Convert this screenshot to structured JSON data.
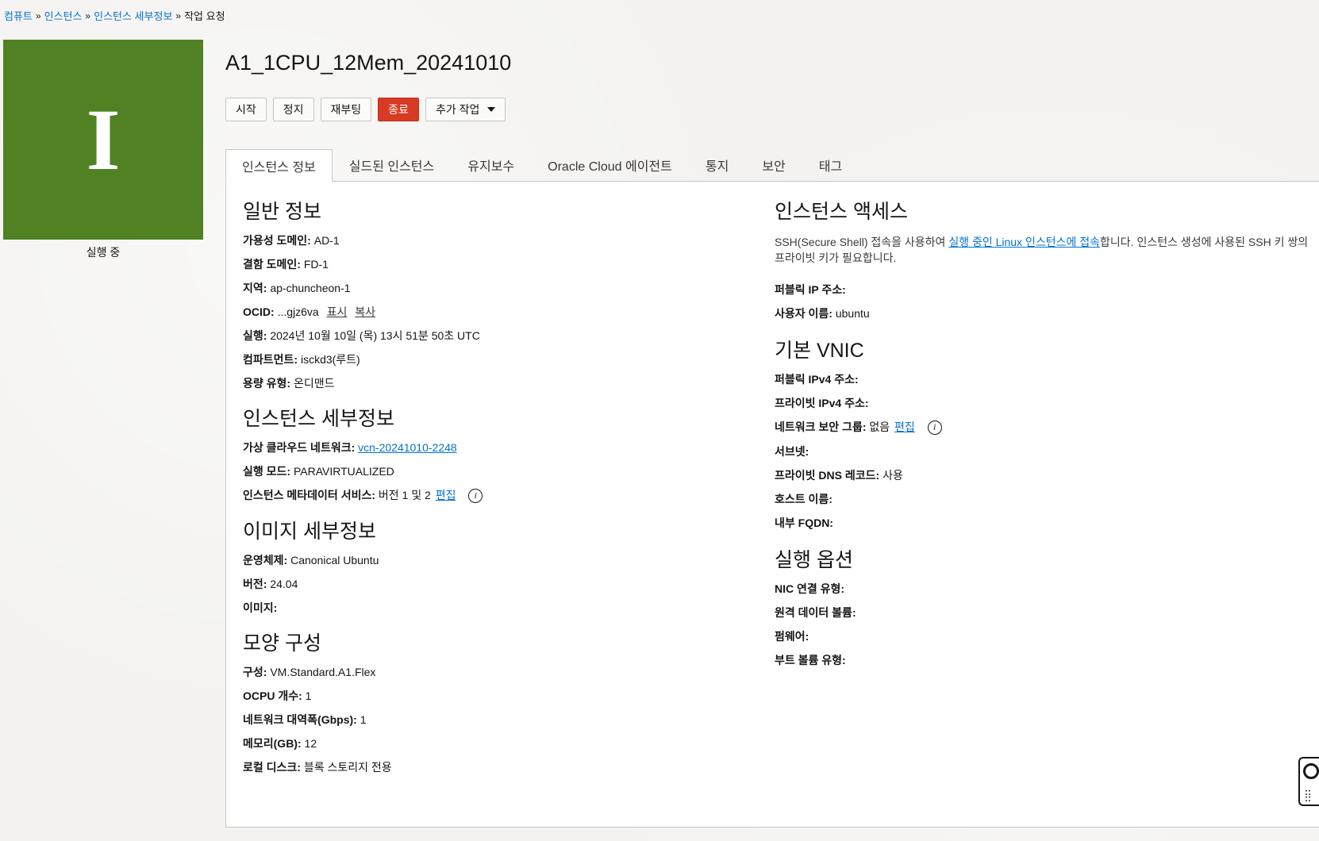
{
  "breadcrumb": {
    "items": [
      "컴퓨트",
      "인스턴스",
      "인스턴스 세부정보"
    ],
    "current": "작업 요청",
    "sep": "»"
  },
  "side": {
    "letter": "I",
    "status": "실행 중",
    "status_color": "#508223"
  },
  "header": {
    "title": "A1_1CPU_12Mem_20241010"
  },
  "actions": {
    "start": "시작",
    "stop": "정지",
    "reboot": "재부팅",
    "terminate": "종료",
    "more": "추가 작업"
  },
  "tabs": [
    "인스턴스 정보",
    "실드된 인스턴스",
    "유지보수",
    "Oracle Cloud 에이전트",
    "통지",
    "보안",
    "태그"
  ],
  "general": {
    "heading": "일반 정보",
    "availability_domain": {
      "k": "가용성 도메인:",
      "v": "AD-1"
    },
    "fault_domain": {
      "k": "결함 도메인:",
      "v": "FD-1"
    },
    "region": {
      "k": "지역:",
      "v": "ap-chuncheon-1"
    },
    "ocid": {
      "k": "OCID:",
      "v": "...gjz6va",
      "show": "표시",
      "copy": "복사"
    },
    "launched": {
      "k": "실행:",
      "v": "2024년 10월 10일 (목) 13시 51분 50초 UTC"
    },
    "compartment": {
      "k": "컴파트먼트:",
      "v": "isckd3(루트)"
    },
    "capacity_type": {
      "k": "용량 유형:",
      "v": "온디맨드"
    }
  },
  "instance_details": {
    "heading": "인스턴스 세부정보",
    "vcn": {
      "k": "가상 클라우드 네트워크:",
      "v": "vcn-20241010-2248"
    },
    "launch_mode": {
      "k": "실행 모드:",
      "v": "PARAVIRTUALIZED"
    },
    "metadata": {
      "k": "인스턴스 메타데이터 서비스:",
      "v": "버전 1 및 2",
      "edit": "편집"
    }
  },
  "image": {
    "heading": "이미지 세부정보",
    "os": {
      "k": "운영체제:",
      "v": "Canonical Ubuntu"
    },
    "version": {
      "k": "버전:",
      "v": "24.04"
    },
    "image": {
      "k": "이미지:",
      "v": ""
    }
  },
  "shape": {
    "heading": "모양 구성",
    "shape": {
      "k": "구성:",
      "v": "VM.Standard.A1.Flex"
    },
    "ocpu": {
      "k": "OCPU 개수:",
      "v": "1"
    },
    "bandwidth": {
      "k": "네트워크 대역폭(Gbps):",
      "v": "1"
    },
    "memory": {
      "k": "메모리(GB):",
      "v": "12"
    },
    "local_disk": {
      "k": "로컬 디스크:",
      "v": "블록 스토리지 전용"
    }
  },
  "access": {
    "heading": "인스턴스 액세스",
    "para_before": "SSH(Secure Shell) 접속을 사용하여 ",
    "para_link": "실행 중인 Linux 인스턴스에 접속",
    "para_after": "합니다. 인스턴스 생성에 사용된 SSH 키 쌍의 프라이빗 키가 필요합니다.",
    "public_ip": {
      "k": "퍼블릭 IP 주소:",
      "v": ""
    },
    "username": {
      "k": "사용자 이름:",
      "v": "ubuntu"
    }
  },
  "vnic": {
    "heading": "기본 VNIC",
    "public_ipv4": {
      "k": "퍼블릭 IPv4 주소:",
      "v": ""
    },
    "private_ipv4": {
      "k": "프라이빗 IPv4 주소:",
      "v": ""
    },
    "nsg": {
      "k": "네트워크 보안 그룹:",
      "v": "없음",
      "edit": "편집"
    },
    "subnet": {
      "k": "서브넷:",
      "v": ""
    },
    "private_dns": {
      "k": "프라이빗 DNS 레코드:",
      "v": "사용"
    },
    "hostname": {
      "k": "호스트 이름:",
      "v": ""
    },
    "fqdn": {
      "k": "내부 FQDN:",
      "v": ""
    }
  },
  "launch_options": {
    "heading": "실행 옵션",
    "nic": {
      "k": "NIC 연결 유형:",
      "v": ""
    },
    "remote_volume": {
      "k": "원격 데이터 볼륨:",
      "v": ""
    },
    "firmware": {
      "k": "펌웨어:",
      "v": ""
    },
    "boot_volume": {
      "k": "부트 볼륨 유형:",
      "v": ""
    }
  },
  "colors": {
    "accent": "#0572ce",
    "danger": "#d83a23",
    "hero": "#508223"
  }
}
